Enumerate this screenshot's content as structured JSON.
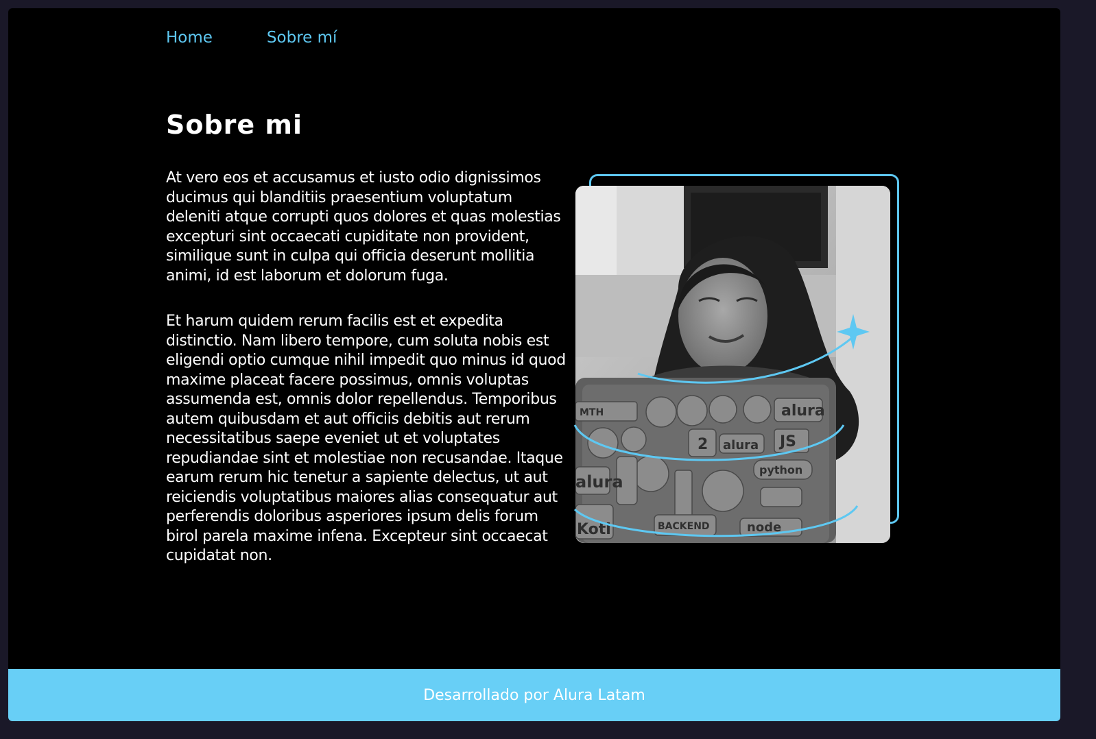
{
  "nav": {
    "items": [
      {
        "label": "Home"
      },
      {
        "label": "Sobre mí"
      }
    ]
  },
  "main": {
    "title": "Sobre mi",
    "paragraphs": [
      "At vero eos et accusamus et iusto odio dignissimos ducimus qui blanditiis praesentium voluptatum deleniti atque corrupti quos dolores et quas molestias excepturi sint occaecati cupiditate non provident, similique sunt in culpa qui officia deserunt mollitia animi, id est laborum et dolorum fuga.",
      "Et harum quidem rerum facilis est et expedita distinctio. Nam libero tempore, cum soluta nobis est eligendi optio cumque nihil impedit quo minus id quod maxime placeat facere possimus, omnis voluptas assumenda est, omnis dolor repellendus. Temporibus autem quibusdam et aut officiis debitis aut rerum necessitatibus saepe eveniet ut et voluptates repudiandae sint et molestiae non recusandae. Itaque earum rerum hic tenetur a sapiente delectus, ut aut reiciendis voluptatibus maiores alias consequatur aut perferendis doloribus asperiores ipsum delis forum birol parela maxime infena. Excepteur sint occaecat cupidatat non."
    ],
    "photo": {
      "sticker_texts": [
        "MTH",
        "I",
        "alura",
        "alura",
        "JS",
        "python",
        "alura",
        "BACKEND",
        "Kotl",
        "node",
        "2"
      ]
    }
  },
  "footer": {
    "text": "Desarrollado por Alura Latam"
  },
  "colors": {
    "accent": "#5ec8f2",
    "footer_bg": "#68cff6",
    "page_bg": "#000000"
  }
}
